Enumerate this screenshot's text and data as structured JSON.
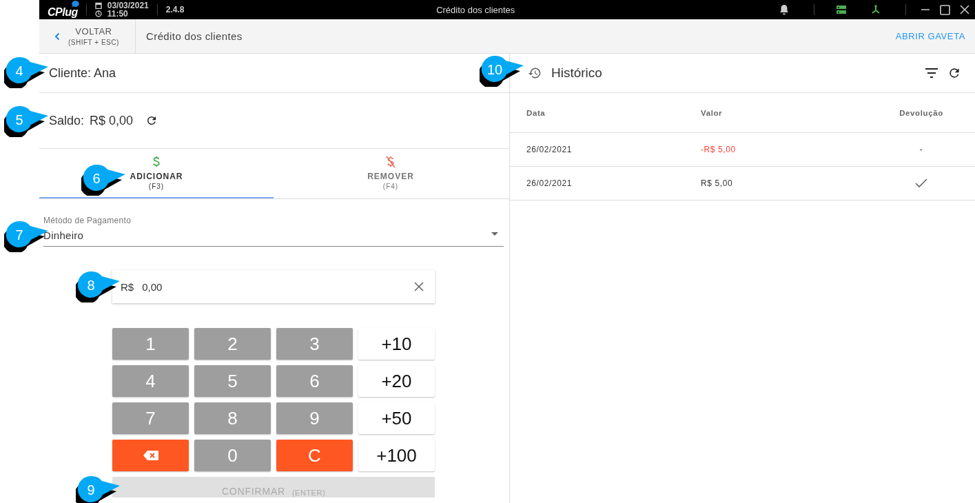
{
  "titlebar": {
    "logo": "CPlug",
    "date": "03/03/2021",
    "time": "11:50",
    "version": "2.4.8",
    "title": "Crédito dos clientes"
  },
  "header": {
    "back_label": "VOLTAR",
    "back_shortcut": "(SHIFT + ESC)",
    "title": "Crédito dos clientes",
    "action": "ABRIR GAVETA"
  },
  "client": {
    "label": "Cliente: Ana"
  },
  "balance": {
    "label": "Saldo:",
    "value": "R$ 0,00"
  },
  "tabs": [
    {
      "label": "ADICIONAR",
      "shortcut": "(F3)",
      "kind": "add",
      "selected": true
    },
    {
      "label": "REMOVER",
      "shortcut": "(F4)",
      "kind": "remove",
      "selected": false
    }
  ],
  "payment_method": {
    "label": "Método de Pagamento",
    "value": "Dinheiro"
  },
  "amount": {
    "prefix": "R$",
    "value": "0,00"
  },
  "keypad": [
    {
      "label": "1",
      "kind": "digit"
    },
    {
      "label": "2",
      "kind": "digit"
    },
    {
      "label": "3",
      "kind": "digit"
    },
    {
      "label": "+10",
      "kind": "add"
    },
    {
      "label": "4",
      "kind": "digit"
    },
    {
      "label": "5",
      "kind": "digit"
    },
    {
      "label": "6",
      "kind": "digit"
    },
    {
      "label": "+20",
      "kind": "add"
    },
    {
      "label": "7",
      "kind": "digit"
    },
    {
      "label": "8",
      "kind": "digit"
    },
    {
      "label": "9",
      "kind": "digit"
    },
    {
      "label": "+50",
      "kind": "add"
    },
    {
      "kind": "backspace"
    },
    {
      "label": "0",
      "kind": "digit"
    },
    {
      "label": "C",
      "kind": "clear"
    },
    {
      "label": "+100",
      "kind": "add"
    }
  ],
  "confirm": {
    "label": "CONFIRMAR",
    "shortcut": "(ENTER)",
    "disabled": true
  },
  "history": {
    "title": "Histórico",
    "columns": [
      "Data",
      "Valor",
      "Devolução"
    ],
    "rows": [
      {
        "date": "26/02/2021",
        "value": "-R$ 5,00",
        "negative": true,
        "returned": false,
        "returned_text": "-"
      },
      {
        "date": "26/02/2021",
        "value": "R$ 5,00",
        "negative": false,
        "returned": true
      }
    ]
  },
  "callouts": [
    {
      "number": "4"
    },
    {
      "number": "5"
    },
    {
      "number": "6"
    },
    {
      "number": "7"
    },
    {
      "number": "8"
    },
    {
      "number": "9"
    },
    {
      "number": "10"
    }
  ]
}
